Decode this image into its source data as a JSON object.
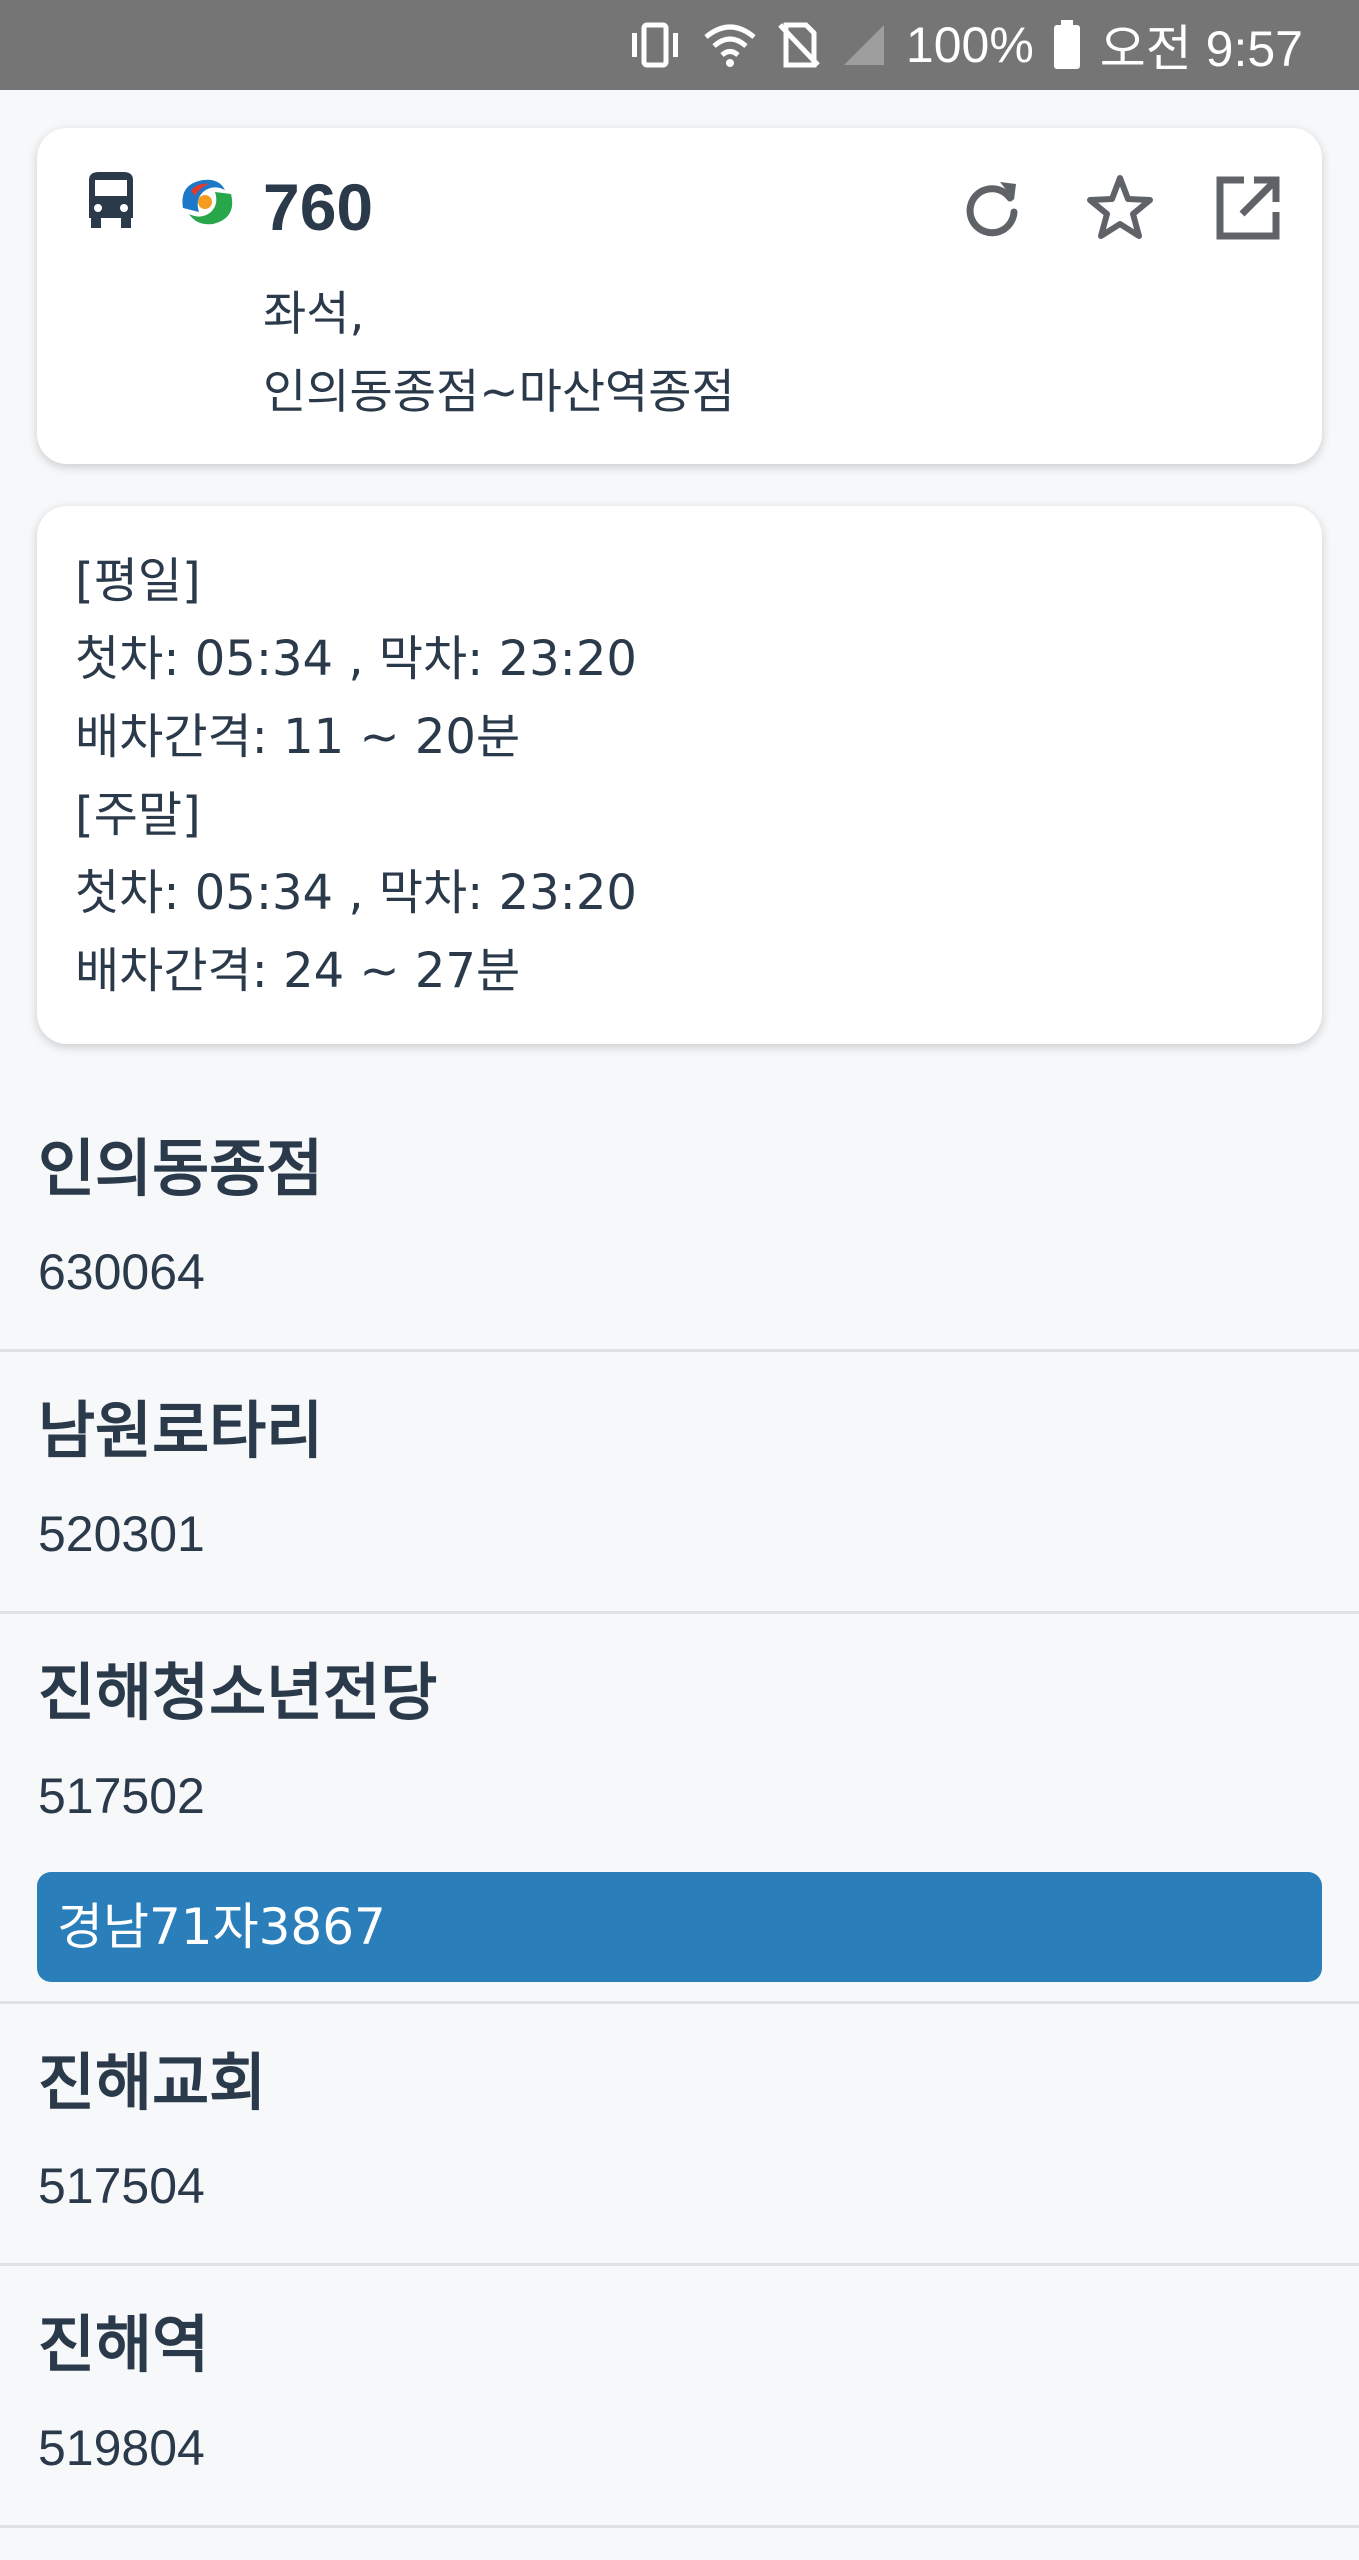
{
  "status_bar": {
    "battery": "100%",
    "time": "오전 9:57",
    "icons": [
      "vibrate-icon",
      "wifi-icon",
      "no-sim-icon",
      "signal-icon",
      "battery-icon"
    ]
  },
  "route": {
    "number": "760",
    "type": "좌석,",
    "terminals": "인의동종점~마산역종점",
    "icons": [
      "bus-icon",
      "city-logo-icon",
      "refresh-icon",
      "star-icon",
      "open-external-icon"
    ]
  },
  "schedule": {
    "lines": [
      "[평일]",
      "첫차: 05:34 , 막차: 23:20",
      "배차간격: 11 ~ 20분",
      "[주말]",
      "첫차: 05:34 , 막차: 23:20",
      "배차간격: 24 ~ 27분"
    ]
  },
  "stops": [
    {
      "name": "인의동종점",
      "id": "630064"
    },
    {
      "name": "남원로타리",
      "id": "520301"
    },
    {
      "name": "진해청소년전당",
      "id": "517502",
      "bus": "경남71자3867"
    },
    {
      "name": "진해교회",
      "id": "517504"
    },
    {
      "name": "진해역",
      "id": "519804"
    }
  ],
  "colors": {
    "status_bar": "#757575",
    "background": "#f6f8fa",
    "text": "#2b3a4a",
    "bus_badge": "#2a7fba",
    "icon": "#5f6368"
  }
}
